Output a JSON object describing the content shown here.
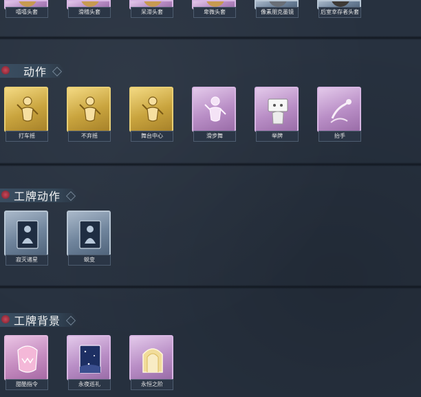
{
  "top_row": [
    {
      "label": "嘻嘻头套",
      "style": "purple",
      "disc": "#c79a52"
    },
    {
      "label": "滑稽头套",
      "style": "purple",
      "disc": "#c79a52"
    },
    {
      "label": "呆滞头套",
      "style": "purple",
      "disc": "#c79a52"
    },
    {
      "label": "卑微头套",
      "style": "purple",
      "disc": "#c79a52"
    },
    {
      "label": "像素朋克墨镜",
      "style": "blue",
      "disc": "#6a6f77"
    },
    {
      "label": "后室幸存者头套",
      "style": "blue",
      "disc": "#3e3a36"
    }
  ],
  "sections": [
    {
      "title": "动作",
      "items": [
        {
          "label": "打车摇",
          "style": "gold",
          "icon": "dancer-icon"
        },
        {
          "label": "不弃摇",
          "style": "gold",
          "icon": "dancer-icon"
        },
        {
          "label": "舞台中心",
          "style": "gold",
          "icon": "dancer-icon"
        },
        {
          "label": "滑步舞",
          "style": "purple",
          "icon": "dancer-icon"
        },
        {
          "label": "举牌",
          "style": "purple",
          "icon": "sign-icon"
        },
        {
          "label": "抬手",
          "style": "purple",
          "icon": "hand-icon"
        }
      ]
    },
    {
      "title": "工牌动作",
      "items": [
        {
          "label": "寂灭诸星",
          "style": "blue",
          "icon": "card-figure-icon"
        },
        {
          "label": "蜕变",
          "style": "blue",
          "icon": "card-figure-icon"
        }
      ]
    },
    {
      "title": "工牌背景",
      "items": [
        {
          "label": "甜酷指令",
          "style": "pink",
          "icon": "pink-creature-icon"
        },
        {
          "label": "永夜巡礼",
          "style": "purple",
          "icon": "starry-frame-icon"
        },
        {
          "label": "永恒之阶",
          "style": "purple",
          "icon": "golden-gate-icon"
        }
      ]
    }
  ]
}
